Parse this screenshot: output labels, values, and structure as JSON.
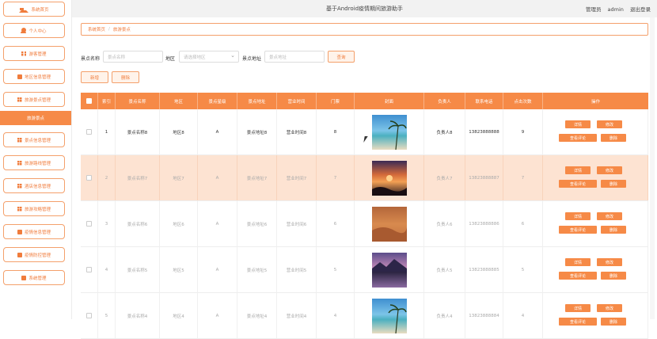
{
  "header": {
    "title": "基于Android疫情期间旅游助手",
    "role": "管理员",
    "user": "admin",
    "logout": "退出登录"
  },
  "sidebar": {
    "items": [
      {
        "label": "系统首页",
        "icon": "home-icon"
      },
      {
        "label": "个人中心",
        "icon": "user-icon"
      },
      {
        "label": "游客管理",
        "icon": "grid-icon"
      },
      {
        "label": "地区信息管理",
        "icon": "box-icon"
      },
      {
        "label": "旅游景点管理",
        "icon": "grid-icon"
      },
      {
        "label": "旅游景点",
        "icon": ""
      },
      {
        "label": "景点信息管理",
        "icon": "grid-icon"
      },
      {
        "label": "旅游路线管理",
        "icon": "grid-icon"
      },
      {
        "label": "酒店信息管理",
        "icon": "grid-icon"
      },
      {
        "label": "旅游攻略管理",
        "icon": "grid-icon"
      },
      {
        "label": "疫情信息管理",
        "icon": "box-icon"
      },
      {
        "label": "疫情防控管理",
        "icon": "box-icon"
      },
      {
        "label": "系统管理",
        "icon": "box-icon"
      }
    ],
    "active_label": "旅游景点"
  },
  "breadcrumb": {
    "home": "系统首页",
    "sep": "/",
    "current": "旅游景点"
  },
  "search": {
    "name_label": "景点名称",
    "name_placeholder": "景点名称",
    "region_label": "地区",
    "region_placeholder": "请选择地区",
    "addr_label": "景点地址",
    "addr_placeholder": "景点地址",
    "query": "查询"
  },
  "toolbar": {
    "add": "新增",
    "delete": "删除"
  },
  "table": {
    "columns": [
      "索引",
      "景点名称",
      "地区",
      "景点星级",
      "景点地址",
      "营业时间",
      "门票",
      "封面",
      "负责人",
      "联系电话",
      "点击次数",
      "操作"
    ],
    "actions": {
      "detail": "详情",
      "edit": "修改",
      "comments": "查看评论",
      "remove": "删除"
    },
    "rows": [
      {
        "idx": "1",
        "name": "景点名称8",
        "region": "地区8",
        "star": "A",
        "addr": "景点地址8",
        "hours": "营业时间8",
        "ticket": "8",
        "manager": "负责人8",
        "phone": "13823888888",
        "clicks": "9"
      },
      {
        "idx": "2",
        "name": "景点名称7",
        "region": "地区7",
        "star": "A",
        "addr": "景点地址7",
        "hours": "营业时间7",
        "ticket": "7",
        "manager": "负责人7",
        "phone": "13823888887",
        "clicks": "7"
      },
      {
        "idx": "3",
        "name": "景点名称6",
        "region": "地区6",
        "star": "A",
        "addr": "景点地址6",
        "hours": "营业时间6",
        "ticket": "6",
        "manager": "负责人6",
        "phone": "13823888886",
        "clicks": "6"
      },
      {
        "idx": "4",
        "name": "景点名称5",
        "region": "地区5",
        "star": "A",
        "addr": "景点地址5",
        "hours": "营业时间5",
        "ticket": "5",
        "manager": "负责人5",
        "phone": "13823888885",
        "clicks": "5"
      },
      {
        "idx": "5",
        "name": "景点名称4",
        "region": "地区4",
        "star": "A",
        "addr": "景点地址4",
        "hours": "营业时间4",
        "ticket": "4",
        "manager": "负责人4",
        "phone": "13823888884",
        "clicks": "4"
      }
    ]
  },
  "colors": {
    "accent": "#f68a47",
    "highlight_row": "#fde3d2"
  }
}
